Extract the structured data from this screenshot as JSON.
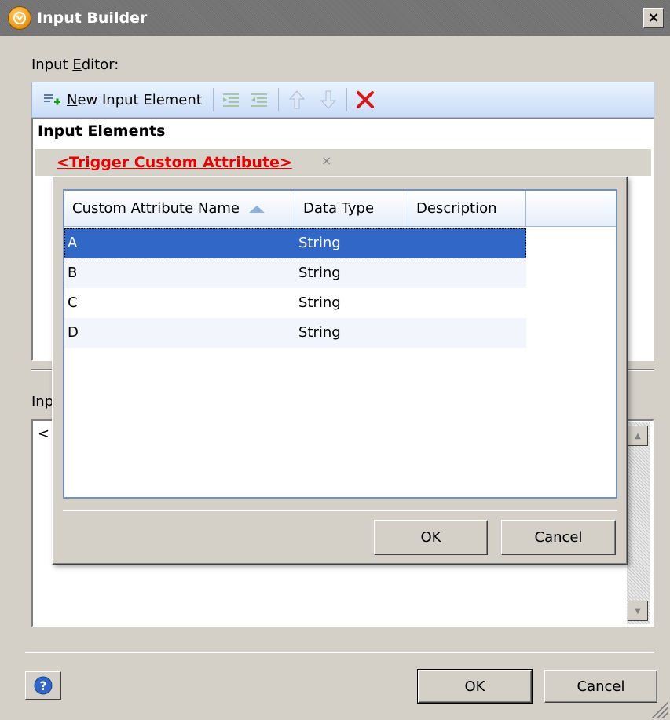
{
  "window": {
    "title": "Input Builder",
    "close_glyph": "×",
    "icon": "app-logo-icon"
  },
  "editor": {
    "label": "Input ",
    "label_accel": "E",
    "label_rest": "ditor:",
    "toolbar": {
      "new_accel": "N",
      "new_rest": "ew Input Element",
      "icons": [
        "add-element-icon",
        "indent-icon",
        "outdent-icon",
        "move-up-icon",
        "move-down-icon",
        "delete-icon"
      ]
    },
    "elements_header": "Input Elements",
    "trigger_element": "<Trigger Custom Attribute>",
    "remove_glyph": "×"
  },
  "preview": {
    "label": "Inp",
    "text": "<"
  },
  "footer": {
    "ok_label": "OK",
    "cancel_label": "Cancel"
  },
  "popup": {
    "columns": [
      "Custom Attribute Name",
      "Data Type",
      "Description"
    ],
    "rows": [
      {
        "name": "A",
        "type": "String",
        "description": ""
      },
      {
        "name": "B",
        "type": "String",
        "description": ""
      },
      {
        "name": "C",
        "type": "String",
        "description": ""
      },
      {
        "name": "D",
        "type": "String",
        "description": ""
      }
    ],
    "selected_row": 0,
    "ok_label": "OK",
    "cancel_label": "Cancel"
  }
}
